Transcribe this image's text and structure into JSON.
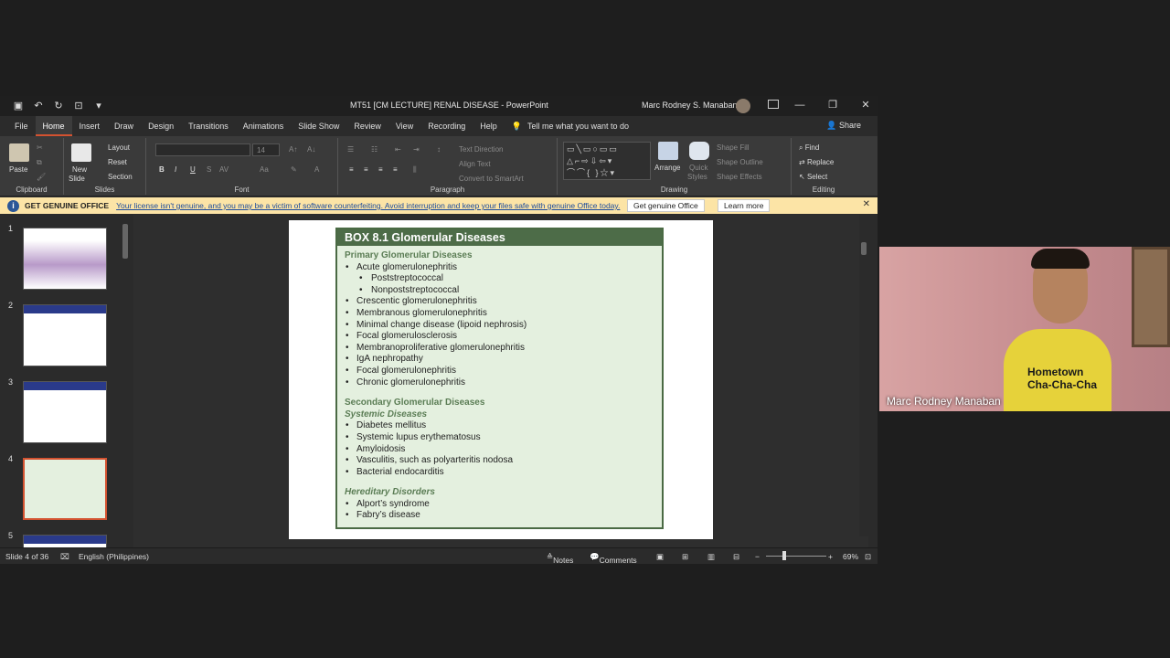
{
  "window": {
    "title": "MT51 [CM LECTURE] RENAL DISEASE  -  PowerPoint",
    "user_name": "Marc Rodney S. Manaban"
  },
  "tabs": [
    "File",
    "Home",
    "Insert",
    "Draw",
    "Design",
    "Transitions",
    "Animations",
    "Slide Show",
    "Review",
    "View",
    "Recording",
    "Help"
  ],
  "active_tab": "Home",
  "tell_me": "Tell me what you want to do",
  "share": "Share",
  "ribbon": {
    "clipboard": {
      "label": "Clipboard",
      "paste": "Paste"
    },
    "slides": {
      "label": "Slides",
      "new_slide": "New",
      "new_slide2": "Slide",
      "layout": "Layout",
      "reset": "Reset",
      "section": "Section"
    },
    "font": {
      "label": "Font",
      "size": "14"
    },
    "paragraph": {
      "label": "Paragraph",
      "text_direction": "Text Direction",
      "align_text": "Align Text",
      "convert": "Convert to SmartArt"
    },
    "drawing": {
      "label": "Drawing",
      "arrange": "Arrange",
      "quick_styles": "Quick",
      "quick_styles2": "Styles",
      "fill": "Shape Fill",
      "outline": "Shape Outline",
      "effects": "Shape Effects"
    },
    "editing": {
      "label": "Editing",
      "find": "Find",
      "replace": "Replace",
      "select": "Select"
    }
  },
  "notice": {
    "head": "GET GENUINE OFFICE",
    "message": "Your license isn't genuine, and you may be a victim of software counterfeiting. Avoid interruption and keep your files safe with genuine Office today.",
    "btn_genuine": "Get genuine Office",
    "btn_learn": "Learn more"
  },
  "thumbnails": [
    {
      "num": "1"
    },
    {
      "num": "2"
    },
    {
      "num": "3"
    },
    {
      "num": "4"
    },
    {
      "num": "5"
    }
  ],
  "slide": {
    "box_title": "BOX 8.1   Glomerular Diseases",
    "primary_heading": "Primary Glomerular Diseases",
    "acute": "Acute glomerulonephritis",
    "post": "Poststreptococcal",
    "nonpost": "Nonpoststreptococcal",
    "primary_items": [
      "Crescentic glomerulonephritis",
      "Membranous glomerulonephritis",
      "Minimal change disease (lipoid nephrosis)",
      "Focal glomerulosclerosis",
      "Membranoproliferative glomerulonephritis",
      "IgA nephropathy",
      "Focal glomerulonephritis",
      "Chronic glomerulonephritis"
    ],
    "secondary_heading": "Secondary Glomerular Diseases",
    "systemic_heading": "Systemic Diseases",
    "systemic_items": [
      "Diabetes mellitus",
      "Systemic lupus erythematosus",
      "Amyloidosis",
      "Vasculitis, such as polyarteritis nodosa",
      "Bacterial endocarditis"
    ],
    "hereditary_heading": "Hereditary Disorders",
    "hereditary_items": [
      "Alport’s syndrome",
      "Fabry’s disease"
    ]
  },
  "status": {
    "slide_of": "Slide 4 of 36",
    "language": "English (Philippines)",
    "notes": "Notes",
    "comments": "Comments",
    "zoom": "69%"
  },
  "webcam": {
    "name": "Marc Rodney Manaban",
    "shirt_line1": "Hometown",
    "shirt_line2": "Cha-Cha-Cha"
  },
  "colors": {
    "accent": "#d35230",
    "box_header": "#4d6c48",
    "box_fill": "#e4f0df",
    "notice_bg": "#fce4a6"
  }
}
